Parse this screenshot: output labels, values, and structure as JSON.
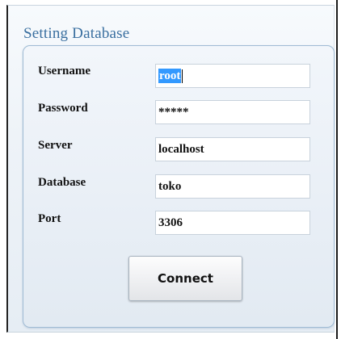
{
  "group": {
    "title": "Setting Database"
  },
  "fields": {
    "username": {
      "label": "Username",
      "value": "root"
    },
    "password": {
      "label": "Password",
      "value": "*****"
    },
    "server": {
      "label": "Server",
      "value": "localhost"
    },
    "database": {
      "label": "Database",
      "value": "toko"
    },
    "port": {
      "label": "Port",
      "value": "3306"
    }
  },
  "buttons": {
    "connect_label": "Connect"
  },
  "colors": {
    "title": "#3a6fa0",
    "selection": "#3399ff",
    "group_border": "#9fbbd4"
  }
}
